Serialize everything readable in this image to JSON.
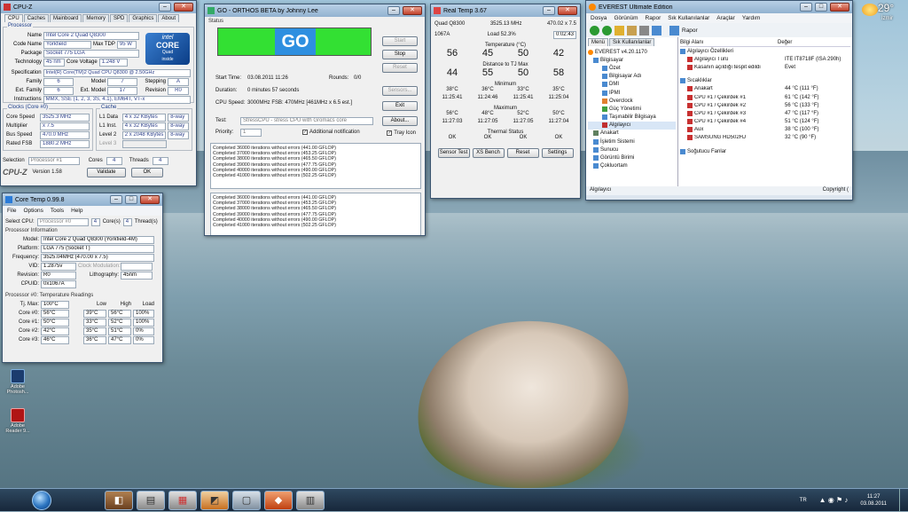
{
  "cpuz": {
    "title": "CPU-Z",
    "tabs": [
      "CPU",
      "Caches",
      "Mainboard",
      "Memory",
      "SPD",
      "Graphics",
      "About"
    ],
    "processor_title": "Processor",
    "name_lbl": "Name",
    "name": "Intel Core 2 Quad Q8300",
    "codename_lbl": "Code Name",
    "codename": "Yorkfield",
    "tdp_lbl": "Max TDP",
    "tdp": "95 W",
    "package_lbl": "Package",
    "package": "Socket 775 LGA",
    "tech_lbl": "Technology",
    "tech": "45 nm",
    "corev_lbl": "Core Voltage",
    "corev": "1.248 V",
    "spec_lbl": "Specification",
    "spec": "Intel(R) Core(TM)2 Quad CPU   Q8300 @ 2.50GHz",
    "family_lbl": "Family",
    "family": "6",
    "model_lbl": "Model",
    "model": "7",
    "stepping_lbl": "Stepping",
    "stepping": "A",
    "extfam_lbl": "Ext. Family",
    "extfam": "6",
    "extmodel_lbl": "Ext. Model",
    "extmodel": "17",
    "revision_lbl": "Revision",
    "revision": "R0",
    "instr_lbl": "Instructions",
    "instr": "MMX, SSE (1, 2, 3, 3S, 4.1), EM64T, VT-x",
    "clocks_title": "Clocks (Core #0)",
    "cs_lbl": "Core Speed",
    "cs": "3525.3 MHz",
    "mult_lbl": "Multiplier",
    "mult": "x 7.5",
    "bus_lbl": "Bus Speed",
    "bus": "470.0 MHz",
    "fsb_lbl": "Rated FSB",
    "fsb": "1880.2 MHz",
    "cache_title": "Cache",
    "l1d_lbl": "L1 Data",
    "l1d": "4 x 32 KBytes",
    "l1d_w": "8-way",
    "l1i_lbl": "L1 Inst.",
    "l1i": "4 x 32 KBytes",
    "l1i_w": "8-way",
    "l2_lbl": "Level 2",
    "l2": "2 x 2048 KBytes",
    "l2_w": "8-way",
    "l3_lbl": "Level 3",
    "selection_lbl": "Selection",
    "selection": "Processor #1",
    "cores_lbl": "Cores",
    "cores": "4",
    "threads_lbl": "Threads",
    "threads": "4",
    "version": "Version 1.58",
    "validate": "Validate",
    "ok": "OK",
    "logo_brand": "intel",
    "logo_line1": "CORE",
    "logo_line2": "Quad",
    "logo_line3": "inside"
  },
  "orthos": {
    "title": "GO - ORTHOS BETA by Johnny Lee",
    "status_lbl": "Status",
    "go": "GO",
    "start": "Start",
    "stop": "Stop",
    "reset": "Reset",
    "sensors": "Sensors...",
    "exit": "Exit",
    "about": "About...",
    "start_time_lbl": "Start Time:",
    "start_time": "03.08.2011 11:26",
    "rounds_lbl": "Rounds:",
    "rounds": "0/0",
    "duration_lbl": "Duration:",
    "duration": "0 minutes 57 seconds",
    "cpuspeed_lbl": "CPU Speed:",
    "cpuspeed": "3000MHz FSB: 470MHz [461MHz x 6.5 est.]",
    "test_lbl": "Test:",
    "test": "StressCPU - stress CPU with Gromacs core",
    "priority_lbl": "Priority:",
    "priority": "1",
    "add_notif": "Additional notification",
    "tray": "Tray Icon",
    "log1": [
      "Completed 36000 iterations without errors (441.00 GFLOP)",
      "Completed 37000 iterations without errors (453.25 GFLOP)",
      "Completed 38000 iterations without errors (465.50 GFLOP)",
      "Completed 39000 iterations without errors (477.75 GFLOP)",
      "Completed 40000 iterations without errors (490.00 GFLOP)",
      "Completed 41000 iterations without errors (502.25 GFLOP)"
    ],
    "log2": [
      "Completed 36000 iterations without errors (441.00 GFLOP)",
      "Completed 37000 iterations without errors (453.25 GFLOP)",
      "Completed 38000 iterations without errors (465.50 GFLOP)",
      "Completed 39000 iterations without errors (477.75 GFLOP)",
      "Completed 40000 iterations without errors (490.00 GFLOP)",
      "Completed 41000 iterations without errors (502.25 GFLOP)"
    ]
  },
  "realtemp": {
    "title": "Real Temp 3.67",
    "cpu": "Quad Q8300",
    "mhz": "3525.13 MHz",
    "mult": "470.02 x 7.5",
    "vid": "1067A",
    "load_lbl": "Load",
    "load": "52.3%",
    "time": "0:02:43",
    "temp_title": "Temperature (°C)",
    "temps": [
      "56",
      "45",
      "50",
      "42"
    ],
    "dist_title": "Distance to TJ Max",
    "dists": [
      "44",
      "55",
      "50",
      "58"
    ],
    "min_title": "Minimum",
    "mins": [
      "38°C",
      "36°C",
      "33°C",
      "35°C"
    ],
    "min_times": [
      "11:25:41",
      "11:24:46",
      "11:25:41",
      "11:25:04"
    ],
    "max_title": "Maximum",
    "maxs": [
      "56°C",
      "48°C",
      "52°C",
      "50°C"
    ],
    "max_times": [
      "11:27:03",
      "11:27:05",
      "11:27:05",
      "11:27:04"
    ],
    "thermal_title": "Thermal Status",
    "thermal": [
      "OK",
      "OK",
      "OK",
      "OK"
    ],
    "buttons": [
      "Sensor Test",
      "XS Bench",
      "Reset",
      "Settings"
    ]
  },
  "everest": {
    "title": "EVEREST Ultimate Edition",
    "menu": [
      "Dosya",
      "Görünüm",
      "Rapor",
      "Sık Kullanılanlar",
      "Araçlar",
      "Yardım"
    ],
    "report": "Rapor",
    "tab_menu": "Menü",
    "tab_fav": "Sık Kullanılanlar",
    "root": "EVEREST v4.20.1170",
    "tree": [
      "Bilgisayar",
      "Özet",
      "Bilgisayar Adı",
      "DMI",
      "IPMI",
      "Overclock",
      "Güç Yönetimi",
      "Taşınabilir Bilgisaya",
      "Algılayıcı",
      "Anakart",
      "İşletim Sistemi",
      "Sunucu",
      "Görüntü Birimi",
      "Çokluortam"
    ],
    "col1": "Bilgi Alanı",
    "col2": "Değer",
    "sec1": "Algılayıcı Özellikleri",
    "p1": "Algılayıcı Türü",
    "v1": "ITE IT8718F  (ISA 290h)",
    "p2": "Kasanın açıldığı tespit edildi",
    "v2": "Evet",
    "sec2": "Sıcaklıklar",
    "temps": [
      {
        "n": "Anakart",
        "v": "44 °C  (111 °F)"
      },
      {
        "n": "CPU #1 / Çekirdek #1",
        "v": "61 °C  (142 °F)"
      },
      {
        "n": "CPU #1 / Çekirdek #2",
        "v": "56 °C  (133 °F)"
      },
      {
        "n": "CPU #1 / Çekirdek #3",
        "v": "47 °C  (117 °F)"
      },
      {
        "n": "CPU #1 / Çekirdek #4",
        "v": "51 °C  (124 °F)"
      },
      {
        "n": "Aux",
        "v": "38 °C  (100 °F)"
      },
      {
        "n": "SAMSUNG HD502HJ",
        "v": "32 °C  (90 °F)"
      }
    ],
    "sec3": "Soğutucu Fanlar",
    "status_l": "Algılayıcı",
    "status_r": "Copyright ("
  },
  "coretemp": {
    "title": "Core Temp 0.99.8",
    "menu": [
      "File",
      "Options",
      "Tools",
      "Help"
    ],
    "select_lbl": "Select CPU:",
    "select": "Processor #0",
    "cores": "4",
    "cores_lbl": "Core(s)",
    "threads": "4",
    "threads_lbl": "Thread(s)",
    "info_title": "Processor Information",
    "model_lbl": "Model:",
    "model": "Intel Core 2 Quad Q8300 (Yorkfield-4M)",
    "platform_lbl": "Platform:",
    "platform": "LGA 775 (Socket T)",
    "freq_lbl": "Frequency:",
    "freq": "3525.04MHz (470.00 x 7.5)",
    "vid_lbl": "VID:",
    "vid": "1.2875v",
    "clockmod_lbl": "Clock Modulation:",
    "rev_lbl": "Revision:",
    "rev": "R0",
    "litho_lbl": "Lithography:",
    "litho": "45nm",
    "cpuid_lbl": "CPUID:",
    "cpuid": "0x1067A",
    "readings_title": "Processor #0: Temperature Readings",
    "tjmax_lbl": "Tj. Max:",
    "tjmax": "100°C",
    "h_low": "Low",
    "h_high": "High",
    "h_load": "Load",
    "cores_list": [
      {
        "n": "Core #0:",
        "t": "56°C",
        "l": "39°C",
        "h": "56°C",
        "ld": "100%"
      },
      {
        "n": "Core #1:",
        "t": "50°C",
        "l": "33°C",
        "h": "52°C",
        "ld": "100%"
      },
      {
        "n": "Core #2:",
        "t": "42°C",
        "l": "35°C",
        "h": "51°C",
        "ld": "0%"
      },
      {
        "n": "Core #3:",
        "t": "46°C",
        "l": "36°C",
        "h": "47°C",
        "ld": "0%"
      }
    ]
  },
  "desktop": {
    "icons": [
      "Adobe Photosh...",
      "Adobe Reader 9..."
    ]
  },
  "weather": {
    "temp": "29°",
    "city": "İzmir"
  },
  "tray": {
    "lang": "TR",
    "time": "11:27",
    "date": "03.08.2011"
  }
}
